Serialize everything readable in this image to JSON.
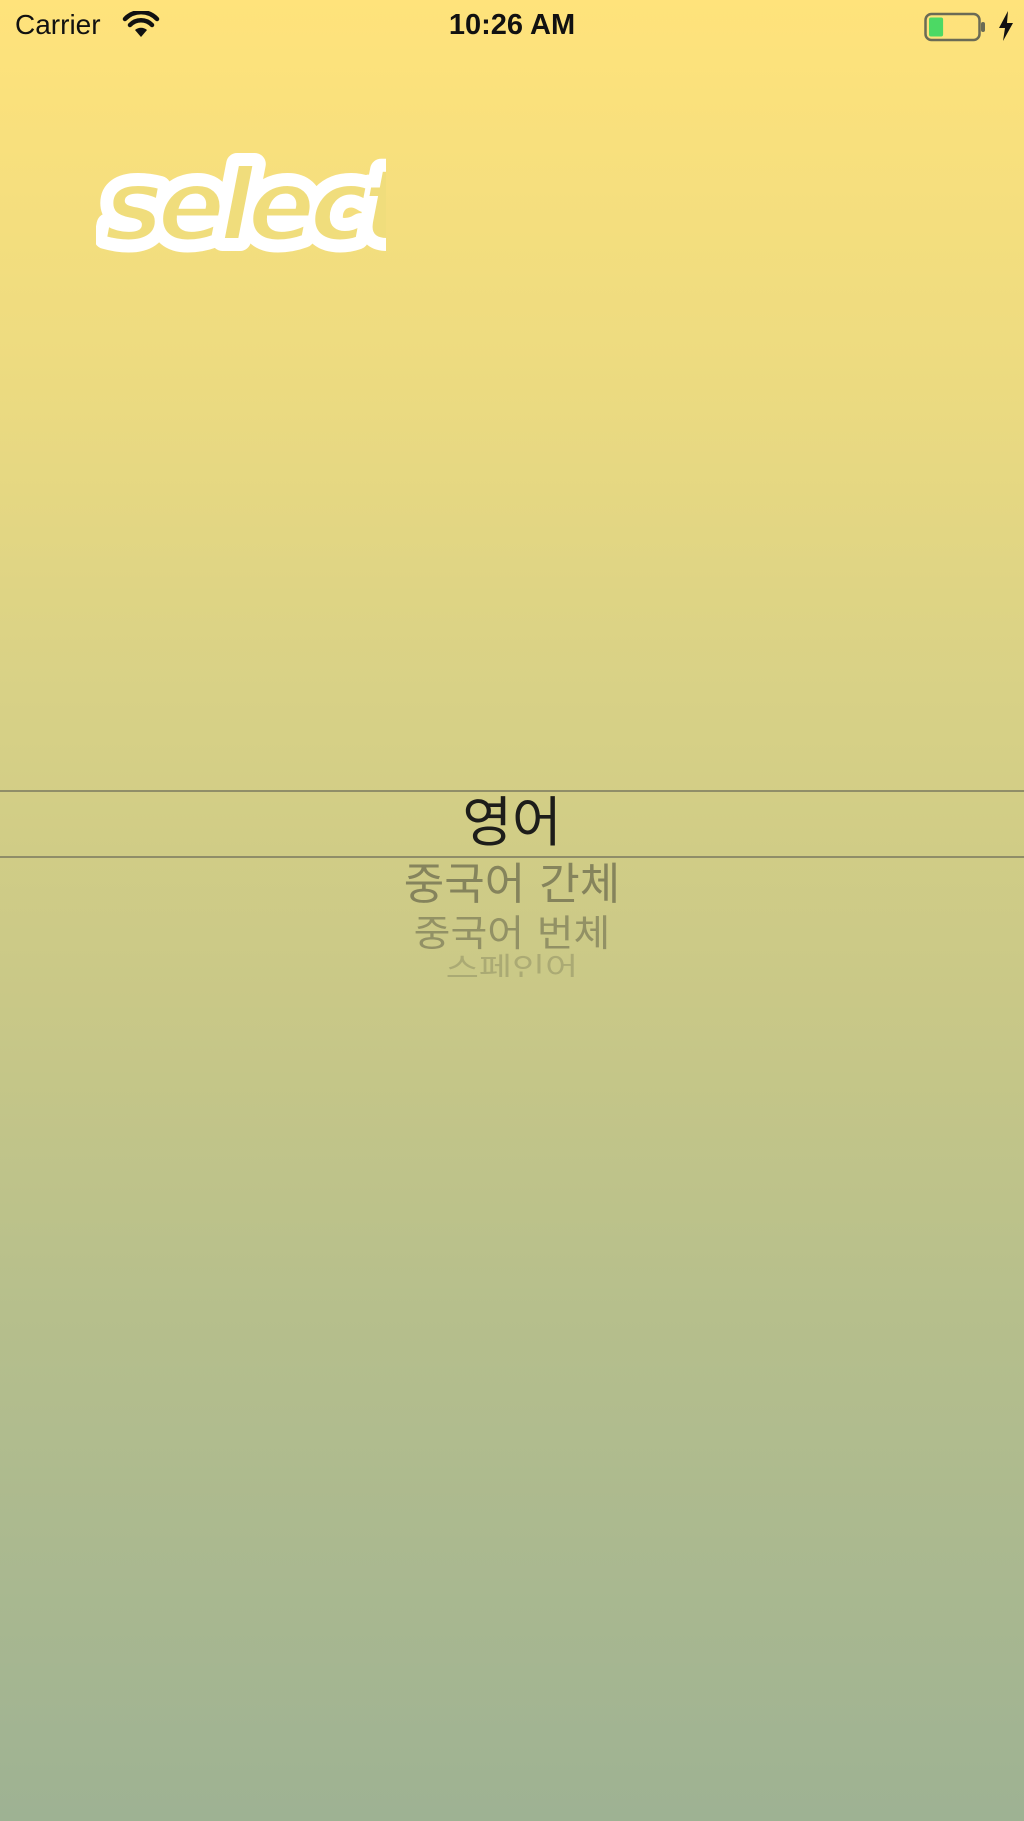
{
  "status_bar": {
    "carrier": "Carrier",
    "time": "10:26 AM",
    "wifi_icon": "wifi-icon",
    "battery_icon": "battery-icon",
    "charging_icon": "charging-bolt-icon",
    "battery_level": 0.3
  },
  "logo": {
    "text": "Select"
  },
  "picker": {
    "selected_index": 0,
    "options": [
      "영어",
      "중국어 간체",
      "중국어 번체",
      "스페인어"
    ]
  },
  "colors": {
    "gradient_top": "#ffe37b",
    "gradient_bottom": "#9eb293",
    "battery_fill": "#4cd964"
  }
}
